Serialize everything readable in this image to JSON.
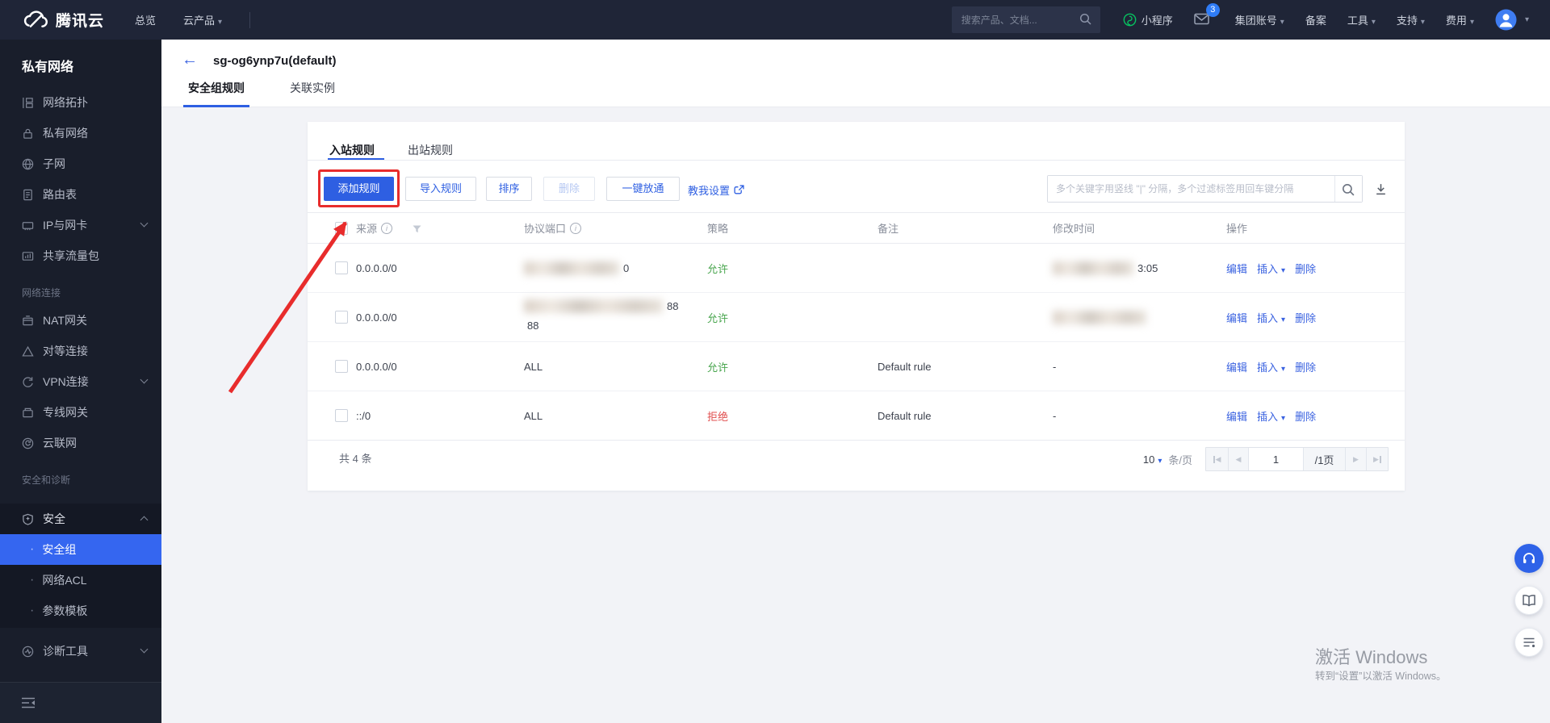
{
  "icons": {
    "info": "i",
    "caret_down": "▾",
    "back": "←",
    "dot": "·",
    "pg_prev": "◀",
    "pg_next": "▶"
  },
  "colors": {
    "accent": "#2e5fe2",
    "allow_green": "#4aa64f",
    "deny_red": "#e04f4f",
    "highlight_red": "#e82c2c",
    "selected_blue": "#3566f0",
    "mini_program_green": "#07c160",
    "badge_blue": "#2f7cf6"
  },
  "topbar": {
    "brand": "腾讯云",
    "nav_overview": "总览",
    "nav_products": "云产品",
    "search_placeholder": "搜索产品、文档...",
    "mini_program": "小程序",
    "mail_badge": "3",
    "account": "集团账号",
    "beian": "备案",
    "tools": "工具",
    "support": "支持",
    "billing": "费用"
  },
  "sidebar": {
    "title": "私有网络",
    "items1": [
      "网络拓扑",
      "私有网络",
      "子网",
      "路由表",
      "IP与网卡",
      "共享流量包"
    ],
    "section2_label": "网络连接",
    "items2": [
      "NAT网关",
      "对等连接",
      "VPN连接",
      "专线网关",
      "云联网"
    ],
    "section3_label": "安全和诊断",
    "security": "安全",
    "security_children": [
      "安全组",
      "网络ACL",
      "参数模板"
    ],
    "diagnostics": "诊断工具"
  },
  "header": {
    "title": "sg-og6ynp7u(default)",
    "tab_rules": "安全组规则",
    "tab_instances": "关联实例"
  },
  "card": {
    "tab_inbound": "入站规则",
    "tab_outbound": "出站规则",
    "btn_add": "添加规则",
    "btn_import": "导入规则",
    "btn_sort": "排序",
    "btn_delete": "删除",
    "btn_open_all": "一键放通",
    "link_teach": "教我设置",
    "search_placeholder": "多个关键字用竖线 \"|\" 分隔，多个过滤标签用回车键分隔",
    "table": {
      "col_source": "来源",
      "col_port": "协议端口",
      "col_policy": "策略",
      "col_note": "备注",
      "col_time": "修改时间",
      "col_action": "操作",
      "actions": {
        "edit": "编辑",
        "insert": "插入",
        "del": "删除"
      },
      "rows": [
        {
          "source": "0.0.0.0/0",
          "port_visible": "0",
          "policy": "允许",
          "note": "",
          "time_visible": "3:05"
        },
        {
          "source": "0.0.0.0/0",
          "port_visible": "88",
          "port_line2": "88",
          "policy": "允许",
          "note": "",
          "time_visible": ""
        },
        {
          "source": "0.0.0.0/0",
          "port": "ALL",
          "policy": "允许",
          "note": "Default rule",
          "time": "-"
        },
        {
          "source": "::/0",
          "port": "ALL",
          "policy": "拒绝",
          "note": "Default rule",
          "time": "-"
        }
      ]
    },
    "footer": {
      "total": "共 4 条",
      "page_size": "10",
      "per_page": "条/页",
      "current": "1",
      "total_pages": "/1页"
    }
  },
  "watermark": {
    "line1": "激活 Windows",
    "line2": "转到“设置”以激活 Windows。"
  }
}
